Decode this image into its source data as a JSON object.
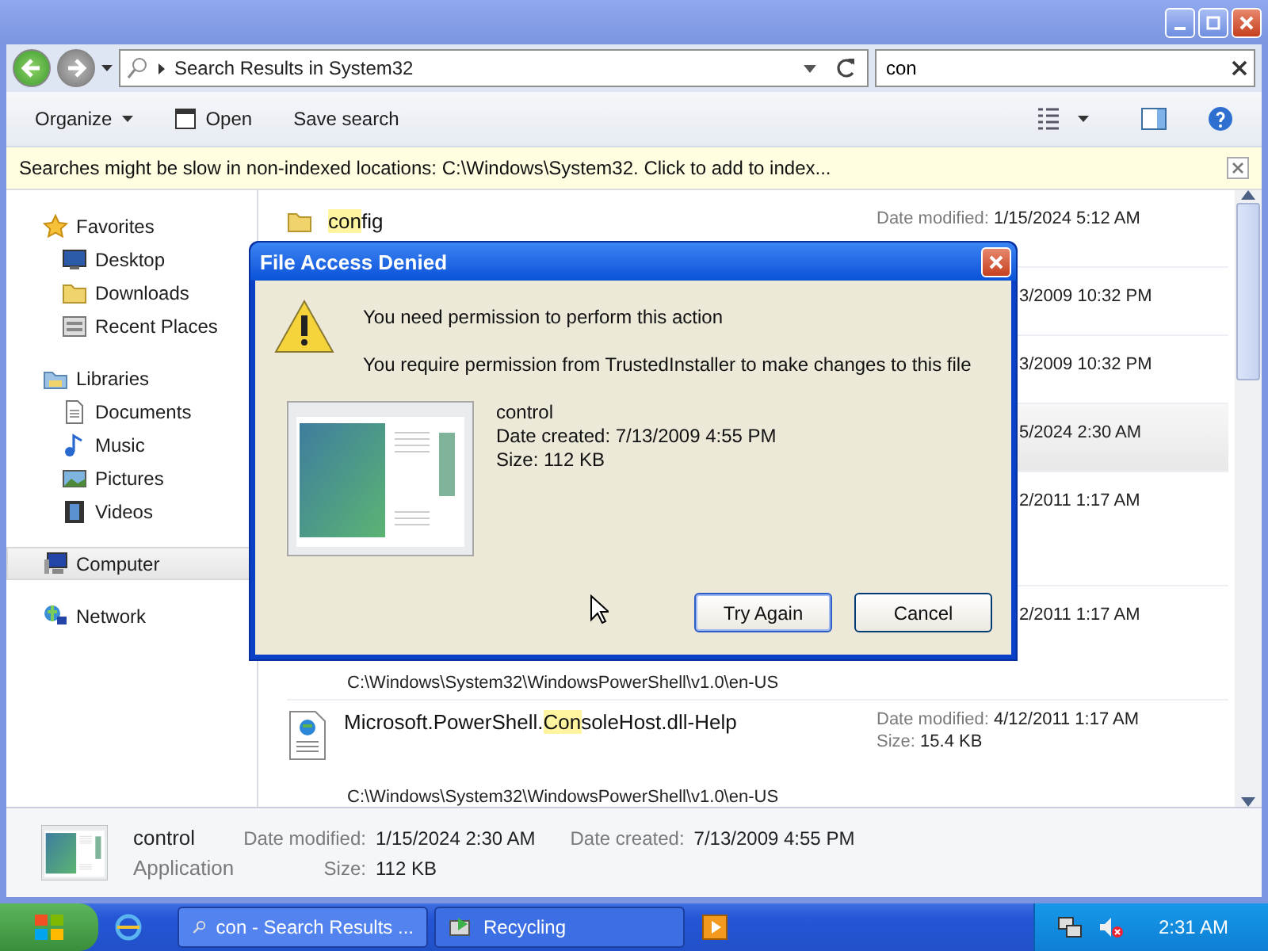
{
  "nav": {
    "address": "Search Results in System32",
    "search_value": "con"
  },
  "commands": [
    "Organize",
    "Open",
    "Save search"
  ],
  "info_bar": "Searches might be slow in non-indexed locations: C:\\Windows\\System32. Click to add to index...",
  "sidebar": [
    {
      "label": "Favorites",
      "selected": false,
      "children": [
        {
          "label": "Desktop",
          "selected": false
        },
        {
          "label": "Downloads",
          "selected": false
        },
        {
          "label": "Recent Places",
          "selected": false
        }
      ]
    },
    {
      "label": "Libraries",
      "selected": false,
      "children": [
        {
          "label": "Documents",
          "selected": false
        },
        {
          "label": "Music",
          "selected": false
        },
        {
          "label": "Pictures",
          "selected": false
        },
        {
          "label": "Videos",
          "selected": false
        }
      ]
    },
    {
      "label": "Computer",
      "selected": true
    },
    {
      "label": "Network",
      "selected": false
    }
  ],
  "results": [
    {
      "kind": "full",
      "name": [
        {
          "text": "con",
          "match": true
        },
        {
          "text": "fig",
          "match": false
        }
      ],
      "modified_label": "Date modified:",
      "modified": "1/15/2024 5:12 AM",
      "selected": false
    },
    {
      "kind": "partial",
      "date": "3/2009 10:32 PM",
      "selected": false
    },
    {
      "kind": "partial",
      "date": "3/2009 10:32 PM",
      "selected": false
    },
    {
      "kind": "partial",
      "date": "5/2024 2:30 AM",
      "selected": true
    },
    {
      "kind": "partial",
      "date": "2/2011 1:17 AM",
      "selected": false
    },
    {
      "kind": "partial",
      "date": "2/2011 1:17 AM",
      "selected": false,
      "path": "C:\\Windows\\System32\\WindowsPowerShell\\v1.0\\en-US"
    },
    {
      "kind": "full",
      "name": [
        {
          "text": "Microsoft.PowerShell.",
          "match": false
        },
        {
          "text": "Con",
          "match": true
        },
        {
          "text": "soleHost.dll-Help",
          "match": false
        }
      ],
      "modified_label": "Date modified:",
      "modified": "4/12/2011 1:17 AM",
      "size_label": "Size:",
      "size": "15.4 KB",
      "selected": false,
      "path": "C:\\Windows\\System32\\WindowsPowerShell\\v1.0\\en-US"
    }
  ],
  "details": {
    "name": "control",
    "type": "Application",
    "modified_label": "Date modified:",
    "modified": "1/15/2024 2:30 AM",
    "created_label": "Date created:",
    "created": "7/13/2009 4:55 PM",
    "size_label": "Size:",
    "size": "112 KB"
  },
  "dialog": {
    "title": "File Access Denied",
    "heading": "You need permission to perform this action",
    "message": "You require permission from TrustedInstaller to make changes to this file",
    "file_name": "control",
    "file_created": "Date created: 7/13/2009 4:55 PM",
    "file_size": "Size: 112 KB",
    "buttons": [
      {
        "label": "Try Again",
        "selected": true
      },
      {
        "label": "Cancel",
        "selected": false
      }
    ]
  },
  "taskbar": {
    "tasks": [
      {
        "label": "con - Search Results ...",
        "selected": true
      },
      {
        "label": "Recycling",
        "selected": false
      }
    ],
    "clock": "2:31 AM"
  }
}
